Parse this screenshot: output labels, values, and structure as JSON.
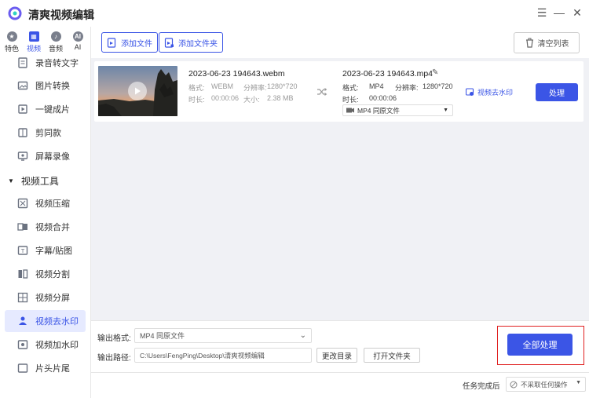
{
  "app": {
    "title": "清爽视频编辑"
  },
  "category_tabs": [
    {
      "label": "特色",
      "icon": "star-icon",
      "glyph": "★"
    },
    {
      "label": "视频",
      "icon": "film-icon",
      "glyph": "▦"
    },
    {
      "label": "音频",
      "icon": "music-icon",
      "glyph": "♪"
    },
    {
      "label": "AI",
      "icon": "ai-icon",
      "glyph": "AI"
    }
  ],
  "sidebar": {
    "items_top": [
      {
        "label": "录音转文字",
        "icon": "mic-icon"
      },
      {
        "label": "图片转换",
        "icon": "image-icon"
      },
      {
        "label": "一键成片",
        "icon": "clip-icon"
      },
      {
        "label": "剪同款",
        "icon": "template-icon"
      },
      {
        "label": "屏幕录像",
        "icon": "screen-record-icon"
      }
    ],
    "section_title": "视频工具",
    "items_tools": [
      {
        "label": "视频压缩",
        "icon": "compress-icon"
      },
      {
        "label": "视频合并",
        "icon": "merge-icon"
      },
      {
        "label": "字幕/贴图",
        "icon": "subtitle-icon"
      },
      {
        "label": "视频分割",
        "icon": "split-icon"
      },
      {
        "label": "视频分屏",
        "icon": "splitscreen-icon"
      },
      {
        "label": "视频去水印",
        "icon": "remove-watermark-icon",
        "active": true
      },
      {
        "label": "视频加水印",
        "icon": "add-watermark-icon"
      },
      {
        "label": "片头片尾",
        "icon": "intro-icon"
      }
    ]
  },
  "toolbar": {
    "add_file": "添加文件",
    "add_folder": "添加文件夹",
    "clear_list": "清空列表"
  },
  "file": {
    "source": {
      "name": "2023-06-23 194643.webm",
      "format_label": "格式:",
      "format": "WEBM",
      "resolution_label": "分辨率:",
      "resolution": "1280*720",
      "duration_label": "时长:",
      "duration": "00:00:06",
      "size_label": "大小:",
      "size": "2.38 MB"
    },
    "output": {
      "name": "2023-06-23 194643.mp4",
      "format_label": "格式:",
      "format": "MP4",
      "resolution_label": "分辨率:",
      "resolution": "1280*720",
      "duration_label": "时长:",
      "duration": "00:00:06",
      "format_select": "MP4 同原文件"
    },
    "watermark_link": "视频去水印",
    "process_button": "处理"
  },
  "settings": {
    "out_format_label": "输出格式:",
    "out_format_value": "MP4 同原文件",
    "out_path_label": "输出路径:",
    "out_path_value": "C:\\Users\\FengPing\\Desktop\\清爽视频编辑",
    "change_dir_button": "更改目录",
    "open_folder_button": "打开文件夹",
    "process_all_button": "全部处理"
  },
  "status": {
    "after_label": "任务完成后",
    "after_value": "不采取任何操作"
  },
  "colors": {
    "accent": "#3b55e6",
    "highlight_frame": "#e02020",
    "workarea": "#f0f1f5"
  }
}
